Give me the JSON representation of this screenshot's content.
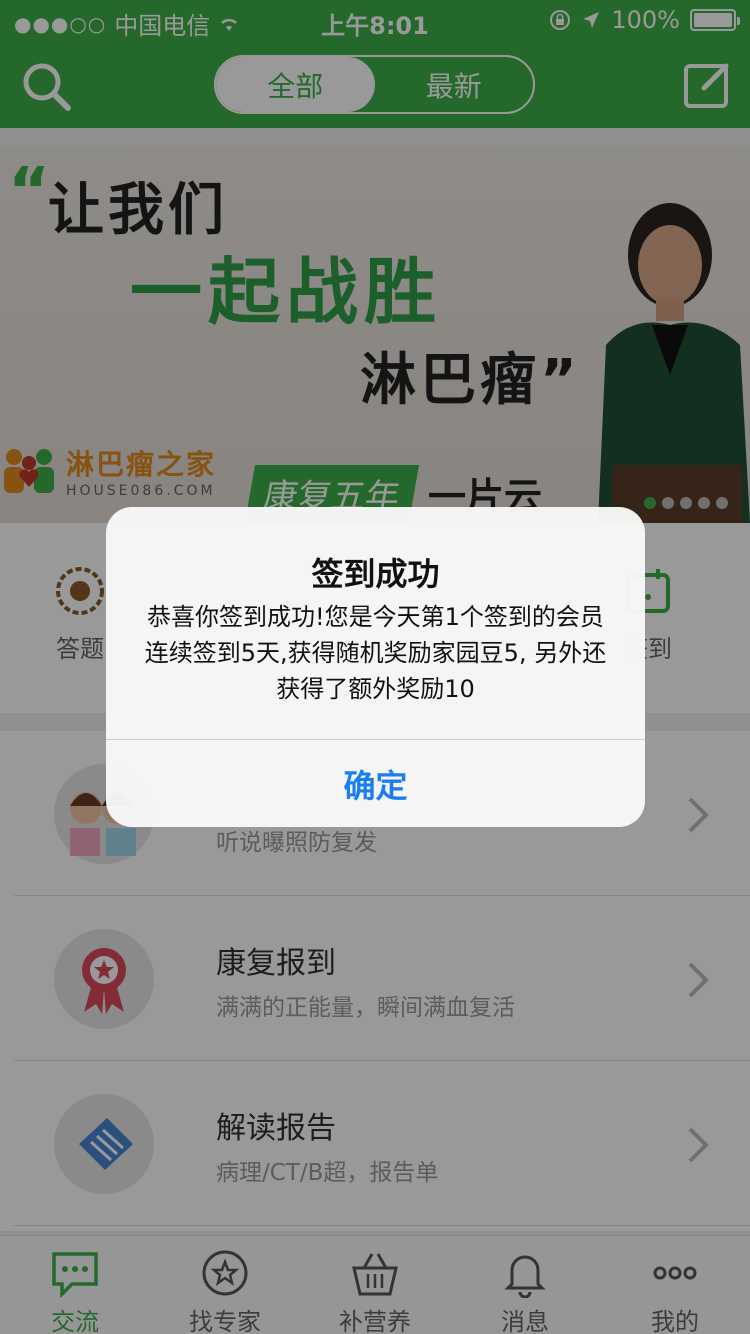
{
  "status_bar": {
    "carrier": "中国电信",
    "time": "上午8:01",
    "battery": "100%"
  },
  "nav": {
    "tabs": [
      {
        "label": "全部",
        "active": true
      },
      {
        "label": "最新",
        "active": false
      }
    ],
    "accent": "#3fae49"
  },
  "banner": {
    "open_quote": "“",
    "line1": "让我们",
    "line2": "一起战胜",
    "line3": "淋巴瘤”",
    "brand_name": "淋巴瘤之家",
    "brand_url": "HOUSE086.COM",
    "story_label": "康复五年",
    "story_name": "一片云"
  },
  "actions": [
    {
      "label": "答题"
    },
    {
      "label": "签到"
    }
  ],
  "list": [
    {
      "title": "",
      "subtitle": "听说曝照防复发"
    },
    {
      "title": "康复报到",
      "subtitle": "满满的正能量，瞬间满血复活"
    },
    {
      "title": "解读报告",
      "subtitle": "病理/CT/B超，报告单"
    }
  ],
  "tabbar": [
    {
      "label": "交流",
      "icon": "chat-bubble-icon",
      "active": true
    },
    {
      "label": "找专家",
      "icon": "star-circle-icon",
      "active": false
    },
    {
      "label": "补营养",
      "icon": "basket-icon",
      "active": false
    },
    {
      "label": "消息",
      "icon": "bell-icon",
      "active": false
    },
    {
      "label": "我的",
      "icon": "more-dots-icon",
      "active": false
    }
  ],
  "alert": {
    "title": "签到成功",
    "message": "恭喜你签到成功!您是今天第1个签到的会员连续签到5天,获得随机奖励家园豆5, 另外还获得了额外奖励10",
    "button": "确定",
    "button_color": "#1a7ef0"
  }
}
